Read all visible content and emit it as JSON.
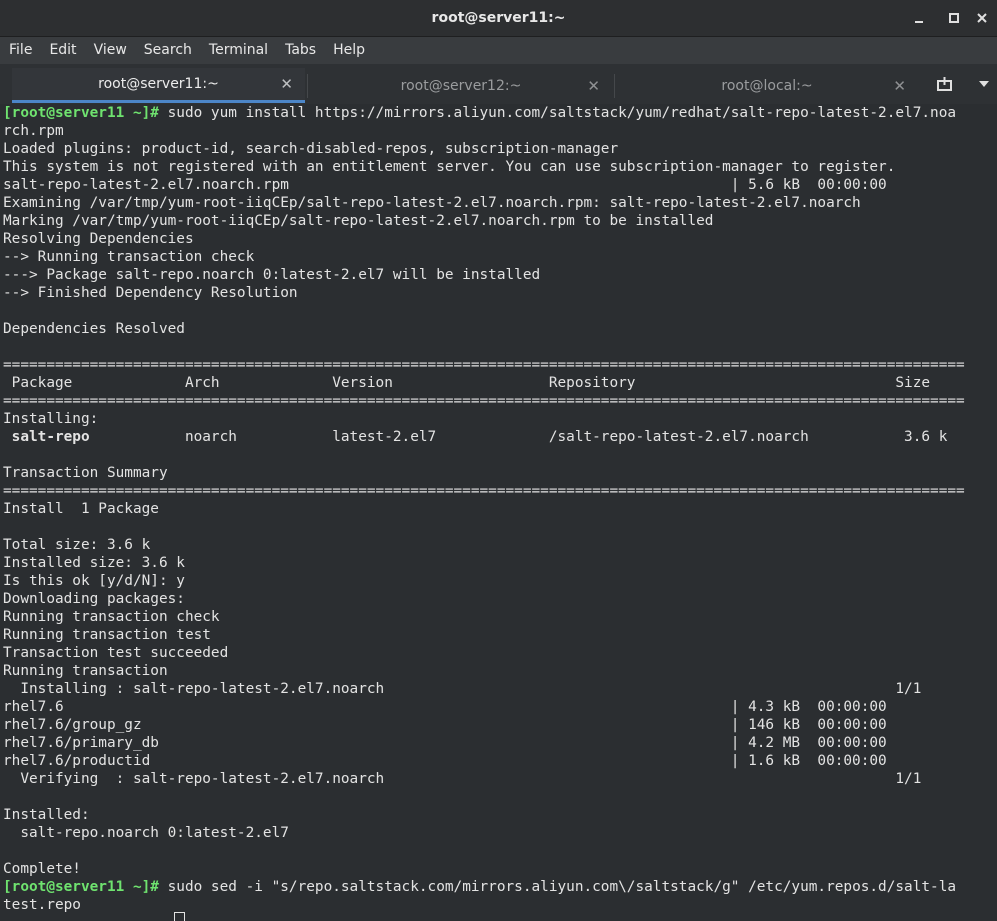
{
  "window": {
    "title": "root@server11:~"
  },
  "menu": [
    "File",
    "Edit",
    "View",
    "Search",
    "Terminal",
    "Tabs",
    "Help"
  ],
  "tabs": [
    {
      "label": "root@server11:~",
      "active": true
    },
    {
      "label": "root@server12:~",
      "active": false
    },
    {
      "label": "root@local:~",
      "active": false
    }
  ],
  "icons": {
    "minimize": "minimize-icon",
    "maximize": "maximize-icon",
    "close": "close-icon",
    "tab_close": "close-icon",
    "new_tab": "new-tab-icon",
    "tab_menu": "chevron-down-icon"
  },
  "colors": {
    "prompt": "#6fe36f",
    "active_tab_underline": "#4c86c8",
    "terminal_bg": "#2b2e31",
    "text": "#e3e3e3"
  },
  "terminal": {
    "lines": [
      {
        "prompt": "[root@server11 ~]#",
        "text": " sudo yum install https://mirrors.aliyun.com/saltstack/yum/redhat/salt-repo-latest-2.el7.noa"
      },
      {
        "text": "rch.rpm"
      },
      {
        "text": "Loaded plugins: product-id, search-disabled-repos, subscription-manager"
      },
      {
        "text": "This system is not registered with an entitlement server. You can use subscription-manager to register."
      },
      {
        "text": "salt-repo-latest-2.el7.noarch.rpm                                                   | 5.6 kB  00:00:00"
      },
      {
        "text": "Examining /var/tmp/yum-root-iiqCEp/salt-repo-latest-2.el7.noarch.rpm: salt-repo-latest-2.el7.noarch"
      },
      {
        "text": "Marking /var/tmp/yum-root-iiqCEp/salt-repo-latest-2.el7.noarch.rpm to be installed"
      },
      {
        "text": "Resolving Dependencies"
      },
      {
        "text": "--> Running transaction check"
      },
      {
        "text": "---> Package salt-repo.noarch 0:latest-2.el7 will be installed"
      },
      {
        "text": "--> Finished Dependency Resolution"
      },
      {
        "text": ""
      },
      {
        "text": "Dependencies Resolved"
      },
      {
        "text": ""
      },
      {
        "text": "==============================================================================================================="
      },
      {
        "text": " Package             Arch             Version                  Repository                              Size"
      },
      {
        "text": "==============================================================================================================="
      },
      {
        "text": "Installing:"
      },
      {
        "bold": " salt-repo",
        "text": "           noarch           latest-2.el7             /salt-repo-latest-2.el7.noarch           3.6 k"
      },
      {
        "text": ""
      },
      {
        "text": "Transaction Summary"
      },
      {
        "text": "==============================================================================================================="
      },
      {
        "text": "Install  1 Package"
      },
      {
        "text": ""
      },
      {
        "text": "Total size: 3.6 k"
      },
      {
        "text": "Installed size: 3.6 k"
      },
      {
        "text": "Is this ok [y/d/N]: y"
      },
      {
        "text": "Downloading packages:"
      },
      {
        "text": "Running transaction check"
      },
      {
        "text": "Running transaction test"
      },
      {
        "text": "Transaction test succeeded"
      },
      {
        "text": "Running transaction"
      },
      {
        "text": "  Installing : salt-repo-latest-2.el7.noarch                                                           1/1"
      },
      {
        "text": "rhel7.6                                                                             | 4.3 kB  00:00:00"
      },
      {
        "text": "rhel7.6/group_gz                                                                    | 146 kB  00:00:00"
      },
      {
        "text": "rhel7.6/primary_db                                                                  | 4.2 MB  00:00:00"
      },
      {
        "text": "rhel7.6/productid                                                                   | 1.6 kB  00:00:00"
      },
      {
        "text": "  Verifying  : salt-repo-latest-2.el7.noarch                                                           1/1"
      },
      {
        "text": ""
      },
      {
        "text": "Installed:"
      },
      {
        "text": "  salt-repo.noarch 0:latest-2.el7"
      },
      {
        "text": ""
      },
      {
        "text": "Complete!"
      },
      {
        "prompt": "[root@server11 ~]#",
        "text": " sudo sed -i \"s/repo.saltstack.com/mirrors.aliyun.com\\/saltstack/g\" /etc/yum.repos.d/salt-la"
      },
      {
        "text": "test.repo"
      }
    ]
  }
}
